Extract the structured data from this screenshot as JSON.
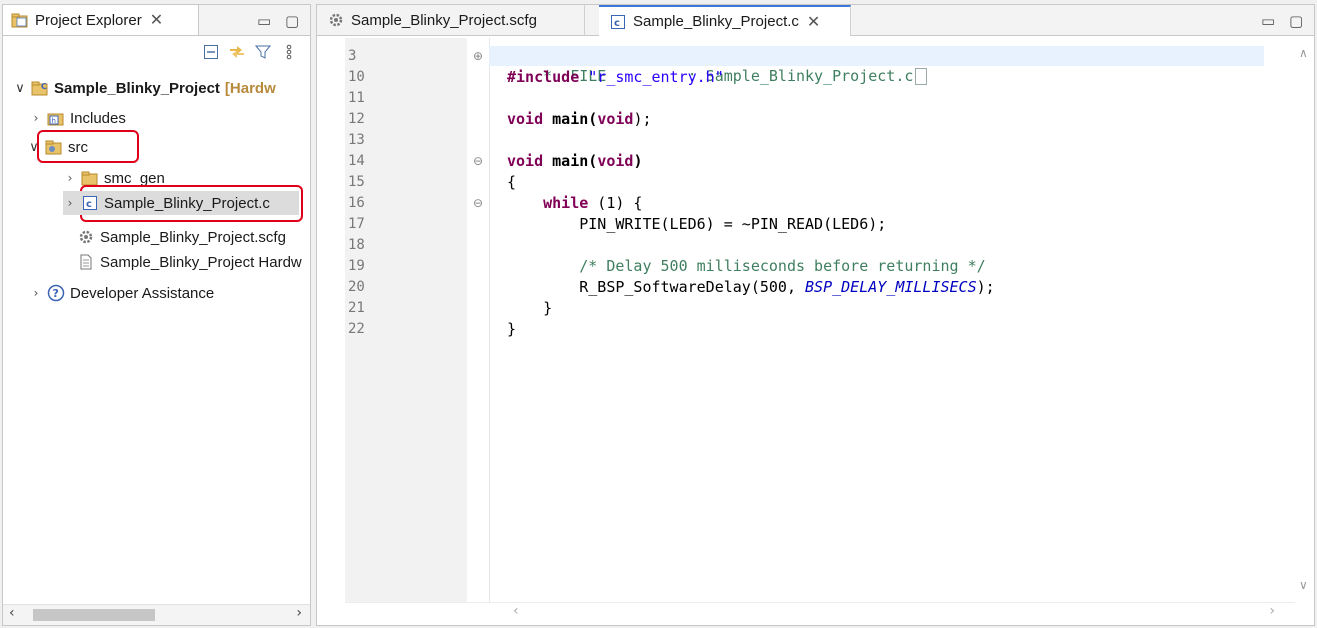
{
  "explorer": {
    "title": "Project Explorer",
    "tree": {
      "project": {
        "name": "Sample_Blinky_Project",
        "suffix": "[Hardw"
      },
      "includes": "Includes",
      "src": "src",
      "smc_gen": "smc_gen",
      "c_file": "Sample_Blinky_Project.c",
      "scfg_file": "Sample_Blinky_Project.scfg",
      "hw_file": "Sample_Blinky_Project Hardw",
      "dev_assist": "Developer Assistance"
    },
    "toolbar_icons": [
      "collapse-all-icon",
      "link-with-editor-icon",
      "filter-icon",
      "view-menu-icon"
    ]
  },
  "editor": {
    "tabs": [
      {
        "label": "Sample_Blinky_Project.scfg",
        "icon": "gear-icon",
        "active": false
      },
      {
        "label": "Sample_Blinky_Project.c",
        "icon": "c-file-icon",
        "active": true
      }
    ],
    "line_numbers": [
      "3",
      "10",
      "11",
      "12",
      "13",
      "14",
      "15",
      "16",
      "17",
      "18",
      "19",
      "20",
      "21",
      "22"
    ],
    "code": {
      "l3": "*  FILE         : Sample_Blinky_Project.c",
      "l10_kw": "#include",
      "l10_str": "\"r_smc_entry.h\"",
      "l12_kw1": "void",
      "l12_fn": "main(",
      "l12_kw2": "void",
      "l12_end": ");",
      "l14_kw1": "void",
      "l14_fn": "main(",
      "l14_kw2": "void",
      "l14_end": ")",
      "l15": "{",
      "l16_kw": "while",
      "l16_rest": " (1) {",
      "l17": "PIN_WRITE(LED6) = ~PIN_READ(LED6);",
      "l19": "/* Delay 500 milliseconds before returning */",
      "l20_pre": "R_BSP_SoftwareDelay(500, ",
      "l20_const": "BSP_DELAY_MILLISECS",
      "l20_end": ");",
      "l21": "}",
      "l22": "}"
    }
  },
  "colors": {
    "highlight_box": "#e0001a",
    "active_tab_accent": "#3c78d8",
    "keyword": "#7f0055",
    "string": "#2a00ff",
    "comment": "#3f7f5f"
  }
}
